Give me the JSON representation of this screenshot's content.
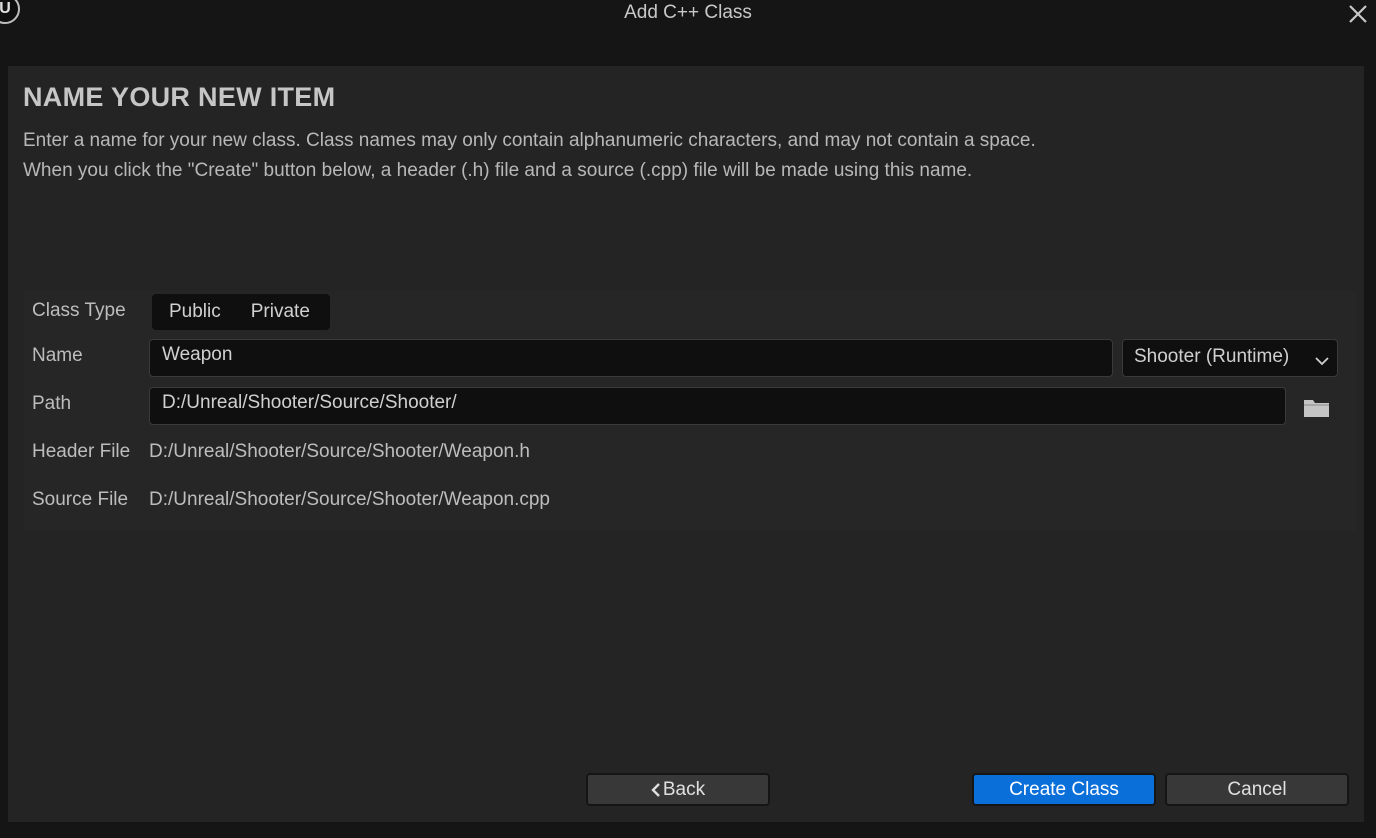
{
  "window": {
    "title": "Add C++ Class",
    "logo_text": "U"
  },
  "page": {
    "heading": "NAME YOUR NEW ITEM",
    "description_line1": "Enter a name for your new class. Class names may only contain alphanumeric characters, and may not contain a space.",
    "description_line2": "When you click the \"Create\" button below, a header (.h) file and a source (.cpp) file will be made using this name."
  },
  "form": {
    "class_type_label": "Class Type",
    "class_type_options": [
      "Public",
      "Private"
    ],
    "name_label": "Name",
    "name_value": "Weapon",
    "module_selected": "Shooter (Runtime)",
    "path_label": "Path",
    "path_value": "D:/Unreal/Shooter/Source/Shooter/",
    "header_file_label": "Header File",
    "header_file_value": "D:/Unreal/Shooter/Source/Shooter/Weapon.h",
    "source_file_label": "Source File",
    "source_file_value": "D:/Unreal/Shooter/Source/Shooter/Weapon.cpp"
  },
  "footer": {
    "back_label": "Back",
    "create_label": "Create Class",
    "cancel_label": "Cancel"
  },
  "icons": {
    "logo": "unreal-logo-icon",
    "close": "close-icon",
    "dropdown": "chevron-down-icon",
    "browse": "folder-icon",
    "back": "chevron-left-icon"
  },
  "colors": {
    "accent": "#0a6fd9",
    "background": "#151515",
    "panel": "#242424"
  }
}
